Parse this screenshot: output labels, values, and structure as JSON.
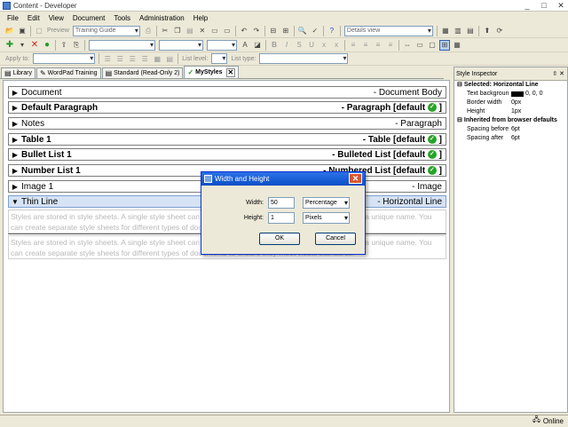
{
  "window": {
    "title": "Content - Developer",
    "controls": [
      "_",
      "□",
      "✕"
    ]
  },
  "menu": [
    "File",
    "Edit",
    "View",
    "Document",
    "Tools",
    "Administration",
    "Help"
  ],
  "toolbar1": {
    "preview_label": "Preview",
    "project_select": "Training Guide",
    "view_select": "Details view"
  },
  "toolbar3": {
    "apply_to_label": "Apply to:",
    "list_level_label": "List level:",
    "list_type_label": "List type:"
  },
  "tabs": [
    {
      "label": "Library",
      "icon": "▤"
    },
    {
      "label": "WordPad Training",
      "icon": "✎"
    },
    {
      "label": "Standard (Read-Only 2)",
      "icon": "▤"
    },
    {
      "label": "MyStyles",
      "icon": "✓",
      "active": true
    }
  ],
  "styles": [
    {
      "name": "Document",
      "tag": "- Document Body",
      "bold": false
    },
    {
      "name": "Default Paragraph",
      "tag": "- Paragraph [default",
      "bold": true,
      "check": true
    },
    {
      "name": "Notes",
      "tag": "- Paragraph",
      "bold": false
    },
    {
      "name": "Table 1",
      "tag": "- Table [default",
      "bold": true,
      "check": true
    },
    {
      "name": "Bullet List 1",
      "tag": "- Bulleted List [default",
      "bold": true,
      "check": true
    },
    {
      "name": "Number List 1",
      "tag": "- Numbered List [default",
      "bold": true,
      "check": true
    },
    {
      "name": "Image 1",
      "tag": "- Image",
      "bold": false
    },
    {
      "name": "Thin Line",
      "tag": "- Horizontal Line",
      "bold": false,
      "selected": true
    }
  ],
  "sample_text": "Styles are stored in style sheets. A single style sheet can be used by many documents and is identified by a unique name. You can create separate style sheets for different types of documents to ensure they meet visual standards.",
  "inspector": {
    "title": "Style Inspector",
    "pin": "⇳ ✕",
    "selected_heading": "Selected: Horizontal Line",
    "selected_props": [
      {
        "key": "Text backgroun",
        "value": "0, 0, 0",
        "swatch": "#000000"
      },
      {
        "key": "Border width",
        "value": "0px"
      },
      {
        "key": "Height",
        "value": "1px"
      }
    ],
    "inherited_heading": "Inherited from browser defaults",
    "inherited_props": [
      {
        "key": "Spacing before",
        "value": "6pt"
      },
      {
        "key": "Spacing after",
        "value": "6pt"
      }
    ]
  },
  "dialog": {
    "title": "Width and Height",
    "width_label": "Width:",
    "width_value": "50",
    "width_unit": "Percentage",
    "height_label": "Height:",
    "height_value": "1",
    "height_unit": "Pixels",
    "ok_label": "OK",
    "cancel_label": "Cancel"
  },
  "status": {
    "text": "Online"
  },
  "colors": {
    "selection": "#d6e3f5",
    "check": "#27a327",
    "dialog_title": "#0b4ec7"
  }
}
